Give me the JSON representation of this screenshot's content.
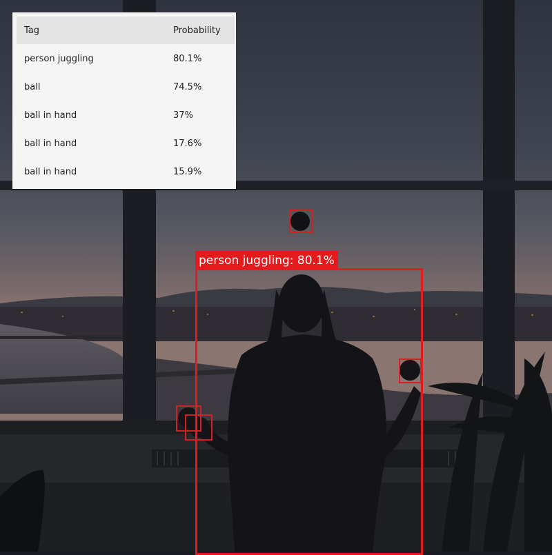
{
  "results_table": {
    "headers": {
      "tag": "Tag",
      "probability": "Probability"
    },
    "rows": [
      {
        "tag": "person juggling",
        "probability": "80.1%"
      },
      {
        "tag": "ball",
        "probability": "74.5%"
      },
      {
        "tag": "ball in hand",
        "probability": "37%"
      },
      {
        "tag": "ball in hand",
        "probability": "17.6%"
      },
      {
        "tag": "ball in hand",
        "probability": "15.9%"
      }
    ]
  },
  "detection_label": "person juggling: 80.1%",
  "colors": {
    "box": "#e41a1c",
    "panel_bg": "#f4f5f4",
    "header_bg": "#e4e4e4"
  }
}
